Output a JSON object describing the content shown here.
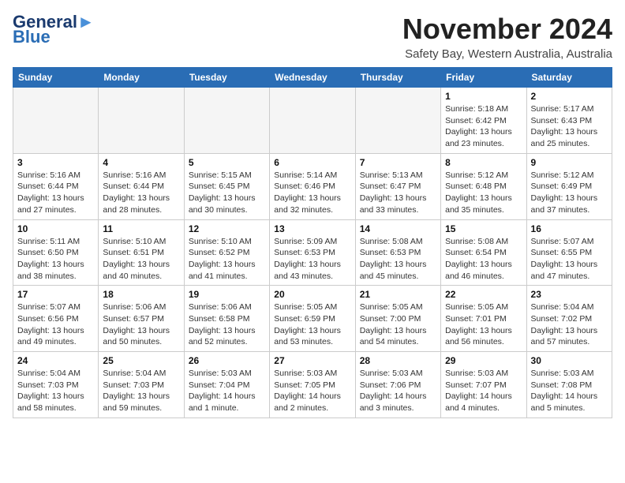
{
  "header": {
    "logo_line1": "General",
    "logo_line2": "Blue",
    "month_title": "November 2024",
    "location": "Safety Bay, Western Australia, Australia"
  },
  "days_of_week": [
    "Sunday",
    "Monday",
    "Tuesday",
    "Wednesday",
    "Thursday",
    "Friday",
    "Saturday"
  ],
  "weeks": [
    [
      {
        "day": "",
        "info": ""
      },
      {
        "day": "",
        "info": ""
      },
      {
        "day": "",
        "info": ""
      },
      {
        "day": "",
        "info": ""
      },
      {
        "day": "",
        "info": ""
      },
      {
        "day": "1",
        "info": "Sunrise: 5:18 AM\nSunset: 6:42 PM\nDaylight: 13 hours\nand 23 minutes."
      },
      {
        "day": "2",
        "info": "Sunrise: 5:17 AM\nSunset: 6:43 PM\nDaylight: 13 hours\nand 25 minutes."
      }
    ],
    [
      {
        "day": "3",
        "info": "Sunrise: 5:16 AM\nSunset: 6:44 PM\nDaylight: 13 hours\nand 27 minutes."
      },
      {
        "day": "4",
        "info": "Sunrise: 5:16 AM\nSunset: 6:44 PM\nDaylight: 13 hours\nand 28 minutes."
      },
      {
        "day": "5",
        "info": "Sunrise: 5:15 AM\nSunset: 6:45 PM\nDaylight: 13 hours\nand 30 minutes."
      },
      {
        "day": "6",
        "info": "Sunrise: 5:14 AM\nSunset: 6:46 PM\nDaylight: 13 hours\nand 32 minutes."
      },
      {
        "day": "7",
        "info": "Sunrise: 5:13 AM\nSunset: 6:47 PM\nDaylight: 13 hours\nand 33 minutes."
      },
      {
        "day": "8",
        "info": "Sunrise: 5:12 AM\nSunset: 6:48 PM\nDaylight: 13 hours\nand 35 minutes."
      },
      {
        "day": "9",
        "info": "Sunrise: 5:12 AM\nSunset: 6:49 PM\nDaylight: 13 hours\nand 37 minutes."
      }
    ],
    [
      {
        "day": "10",
        "info": "Sunrise: 5:11 AM\nSunset: 6:50 PM\nDaylight: 13 hours\nand 38 minutes."
      },
      {
        "day": "11",
        "info": "Sunrise: 5:10 AM\nSunset: 6:51 PM\nDaylight: 13 hours\nand 40 minutes."
      },
      {
        "day": "12",
        "info": "Sunrise: 5:10 AM\nSunset: 6:52 PM\nDaylight: 13 hours\nand 41 minutes."
      },
      {
        "day": "13",
        "info": "Sunrise: 5:09 AM\nSunset: 6:53 PM\nDaylight: 13 hours\nand 43 minutes."
      },
      {
        "day": "14",
        "info": "Sunrise: 5:08 AM\nSunset: 6:53 PM\nDaylight: 13 hours\nand 45 minutes."
      },
      {
        "day": "15",
        "info": "Sunrise: 5:08 AM\nSunset: 6:54 PM\nDaylight: 13 hours\nand 46 minutes."
      },
      {
        "day": "16",
        "info": "Sunrise: 5:07 AM\nSunset: 6:55 PM\nDaylight: 13 hours\nand 47 minutes."
      }
    ],
    [
      {
        "day": "17",
        "info": "Sunrise: 5:07 AM\nSunset: 6:56 PM\nDaylight: 13 hours\nand 49 minutes."
      },
      {
        "day": "18",
        "info": "Sunrise: 5:06 AM\nSunset: 6:57 PM\nDaylight: 13 hours\nand 50 minutes."
      },
      {
        "day": "19",
        "info": "Sunrise: 5:06 AM\nSunset: 6:58 PM\nDaylight: 13 hours\nand 52 minutes."
      },
      {
        "day": "20",
        "info": "Sunrise: 5:05 AM\nSunset: 6:59 PM\nDaylight: 13 hours\nand 53 minutes."
      },
      {
        "day": "21",
        "info": "Sunrise: 5:05 AM\nSunset: 7:00 PM\nDaylight: 13 hours\nand 54 minutes."
      },
      {
        "day": "22",
        "info": "Sunrise: 5:05 AM\nSunset: 7:01 PM\nDaylight: 13 hours\nand 56 minutes."
      },
      {
        "day": "23",
        "info": "Sunrise: 5:04 AM\nSunset: 7:02 PM\nDaylight: 13 hours\nand 57 minutes."
      }
    ],
    [
      {
        "day": "24",
        "info": "Sunrise: 5:04 AM\nSunset: 7:03 PM\nDaylight: 13 hours\nand 58 minutes."
      },
      {
        "day": "25",
        "info": "Sunrise: 5:04 AM\nSunset: 7:03 PM\nDaylight: 13 hours\nand 59 minutes."
      },
      {
        "day": "26",
        "info": "Sunrise: 5:03 AM\nSunset: 7:04 PM\nDaylight: 14 hours\nand 1 minute."
      },
      {
        "day": "27",
        "info": "Sunrise: 5:03 AM\nSunset: 7:05 PM\nDaylight: 14 hours\nand 2 minutes."
      },
      {
        "day": "28",
        "info": "Sunrise: 5:03 AM\nSunset: 7:06 PM\nDaylight: 14 hours\nand 3 minutes."
      },
      {
        "day": "29",
        "info": "Sunrise: 5:03 AM\nSunset: 7:07 PM\nDaylight: 14 hours\nand 4 minutes."
      },
      {
        "day": "30",
        "info": "Sunrise: 5:03 AM\nSunset: 7:08 PM\nDaylight: 14 hours\nand 5 minutes."
      }
    ]
  ]
}
